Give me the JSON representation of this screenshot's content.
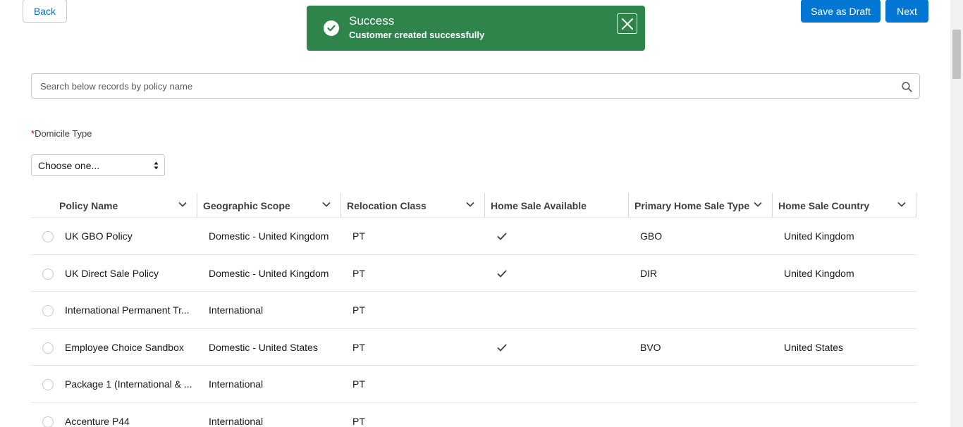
{
  "header": {
    "back_label": "Back",
    "save_draft_label": "Save as Draft",
    "next_label": "Next"
  },
  "toast": {
    "title": "Success",
    "message": "Customer created successfully",
    "color": "#2e844a"
  },
  "search": {
    "placeholder": "Search below records by policy name",
    "value": ""
  },
  "domicile": {
    "required_mark": "*",
    "label": "Domicile Type",
    "selected": "Choose one..."
  },
  "table": {
    "columns": [
      "Policy Name",
      "Geographic Scope",
      "Relocation Class",
      "Home Sale Available",
      "Primary Home Sale Type",
      "Home Sale Country"
    ],
    "rows": [
      {
        "policy": "UK GBO Policy",
        "scope": "Domestic - United Kingdom",
        "class": "PT",
        "home_sale_available": true,
        "sale_type": "GBO",
        "country": "United Kingdom"
      },
      {
        "policy": "UK Direct Sale Policy",
        "scope": "Domestic - United Kingdom",
        "class": "PT",
        "home_sale_available": true,
        "sale_type": "DIR",
        "country": "United Kingdom"
      },
      {
        "policy": "International Permanent Tr...",
        "scope": "International",
        "class": "PT",
        "home_sale_available": false,
        "sale_type": "",
        "country": ""
      },
      {
        "policy": "Employee Choice Sandbox",
        "scope": "Domestic - United States",
        "class": "PT",
        "home_sale_available": true,
        "sale_type": "BVO",
        "country": "United States"
      },
      {
        "policy": "Package 1 (International & ...",
        "scope": "International",
        "class": "PT",
        "home_sale_available": false,
        "sale_type": "",
        "country": ""
      },
      {
        "policy": "Accenture P44",
        "scope": "International",
        "class": "PT",
        "home_sale_available": false,
        "sale_type": "",
        "country": ""
      }
    ]
  },
  "colors": {
    "brand": "#0176d3",
    "success": "#2e844a"
  }
}
